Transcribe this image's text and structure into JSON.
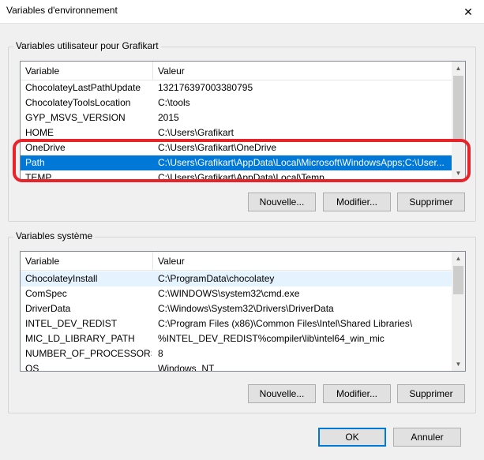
{
  "window": {
    "title": "Variables d'environnement",
    "close_glyph": "✕"
  },
  "user_vars": {
    "group_label": "Variables utilisateur pour Grafikart",
    "col_variable": "Variable",
    "col_value": "Valeur",
    "rows": [
      {
        "name": "ChocolateyLastPathUpdate",
        "value": "132176397003380795"
      },
      {
        "name": "ChocolateyToolsLocation",
        "value": "C:\\tools"
      },
      {
        "name": "GYP_MSVS_VERSION",
        "value": "2015"
      },
      {
        "name": "HOME",
        "value": "C:\\Users\\Grafikart"
      },
      {
        "name": "OneDrive",
        "value": "C:\\Users\\Grafikart\\OneDrive"
      },
      {
        "name": "Path",
        "value": "C:\\Users\\Grafikart\\AppData\\Local\\Microsoft\\WindowsApps;C:\\User..."
      },
      {
        "name": "TEMP",
        "value": "C:\\Users\\Grafikart\\AppData\\Local\\Temp"
      }
    ],
    "selected_row": "Path",
    "buttons": {
      "new": "Nouvelle...",
      "edit": "Modifier...",
      "delete": "Supprimer"
    }
  },
  "system_vars": {
    "group_label": "Variables système",
    "col_variable": "Variable",
    "col_value": "Valeur",
    "rows": [
      {
        "name": "ChocolateyInstall",
        "value": "C:\\ProgramData\\chocolatey"
      },
      {
        "name": "ComSpec",
        "value": "C:\\WINDOWS\\system32\\cmd.exe"
      },
      {
        "name": "DriverData",
        "value": "C:\\Windows\\System32\\Drivers\\DriverData"
      },
      {
        "name": "INTEL_DEV_REDIST",
        "value": "C:\\Program Files (x86)\\Common Files\\Intel\\Shared Libraries\\"
      },
      {
        "name": "MIC_LD_LIBRARY_PATH",
        "value": "%INTEL_DEV_REDIST%compiler\\lib\\intel64_win_mic"
      },
      {
        "name": "NUMBER_OF_PROCESSORS",
        "value": "8"
      },
      {
        "name": "OS",
        "value": "Windows_NT"
      }
    ],
    "buttons": {
      "new": "Nouvelle...",
      "edit": "Modifier...",
      "delete": "Supprimer"
    }
  },
  "footer": {
    "ok": "OK",
    "cancel": "Annuler"
  },
  "colors": {
    "selection": "#0078d7",
    "highlight_annotation": "#e8242b",
    "default_button_border": "#0078d7"
  },
  "icons": {
    "close": "close-icon",
    "scroll_up": "chevron-up-icon",
    "scroll_down": "chevron-down-icon"
  }
}
